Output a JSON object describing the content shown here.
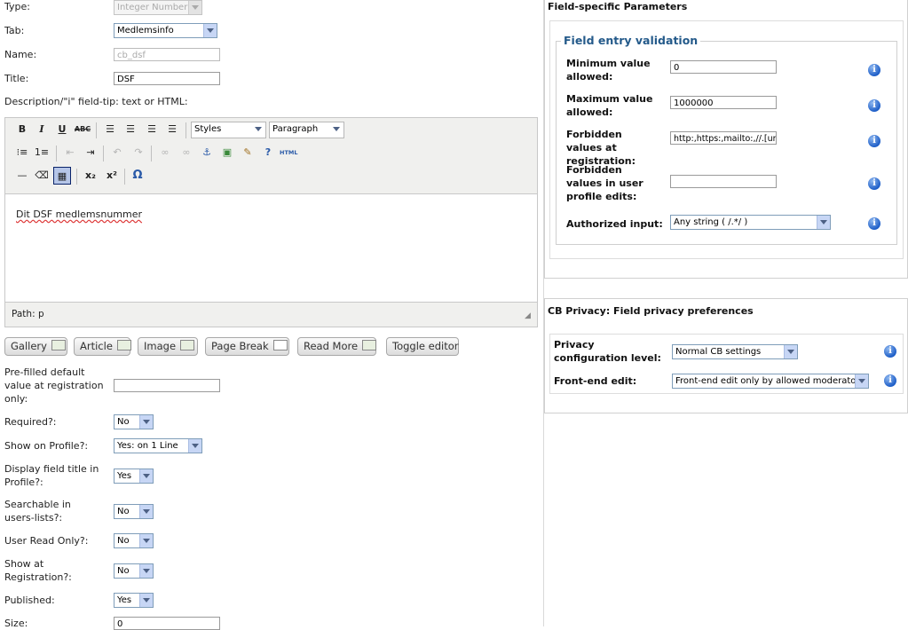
{
  "left": {
    "type_label": "Type:",
    "type_value": "Integer Number",
    "tab_label": "Tab:",
    "tab_value": "Medlemsinfo",
    "name_label": "Name:",
    "name_value": "cb_dsf",
    "title_label": "Title:",
    "title_value": "DSF",
    "description_label": "Description/\"i\" field-tip: text or HTML:",
    "editor": {
      "styles_value": "Styles",
      "format_value": "Paragraph",
      "content_text": "Dit DSF medlemsnummer",
      "path_text": "Path: p",
      "html_label": "HTML"
    },
    "buttons": {
      "gallery": "Gallery",
      "article": "Article",
      "image": "Image",
      "page_break": "Page Break",
      "read_more": "Read More",
      "toggle_editor": "Toggle editor"
    },
    "prefilled_label": "Pre-filled default value at registration only:",
    "prefilled_value": "",
    "required_label": "Required?:",
    "required_value": "No",
    "show_profile_label": "Show on Profile?:",
    "show_profile_value": "Yes: on 1 Line",
    "display_title_label": "Display field title in Profile?:",
    "display_title_value": "Yes",
    "searchable_label": "Searchable in users-lists?:",
    "searchable_value": "No",
    "readonly_label": "User Read Only?:",
    "readonly_value": "No",
    "show_reg_label": "Show at Registration?:",
    "show_reg_value": "No",
    "published_label": "Published:",
    "published_value": "Yes",
    "size_label": "Size:",
    "size_value": "0"
  },
  "right": {
    "params_title": "Field-specific Parameters",
    "validation_legend": "Field entry validation",
    "min_label": "Minimum value allowed:",
    "min_value": "0",
    "max_label": "Maximum value allowed:",
    "max_value": "1000000",
    "forbid_reg_label": "Forbidden values at registration:",
    "forbid_reg_value": "http:,https:,mailto:,//.[url]",
    "forbid_edit_label": "Forbidden values in user profile edits:",
    "forbid_edit_value": "",
    "authorized_label": "Authorized input:",
    "authorized_value": "Any string ( /.*/ )",
    "privacy_title": "CB Privacy: Field privacy preferences",
    "privacy_level_label": "Privacy configuration level:",
    "privacy_level_value": "Normal CB settings",
    "frontend_label": "Front-end edit:",
    "frontend_value": "Front-end edit only by allowed moderators",
    "info_glyph": "i"
  }
}
